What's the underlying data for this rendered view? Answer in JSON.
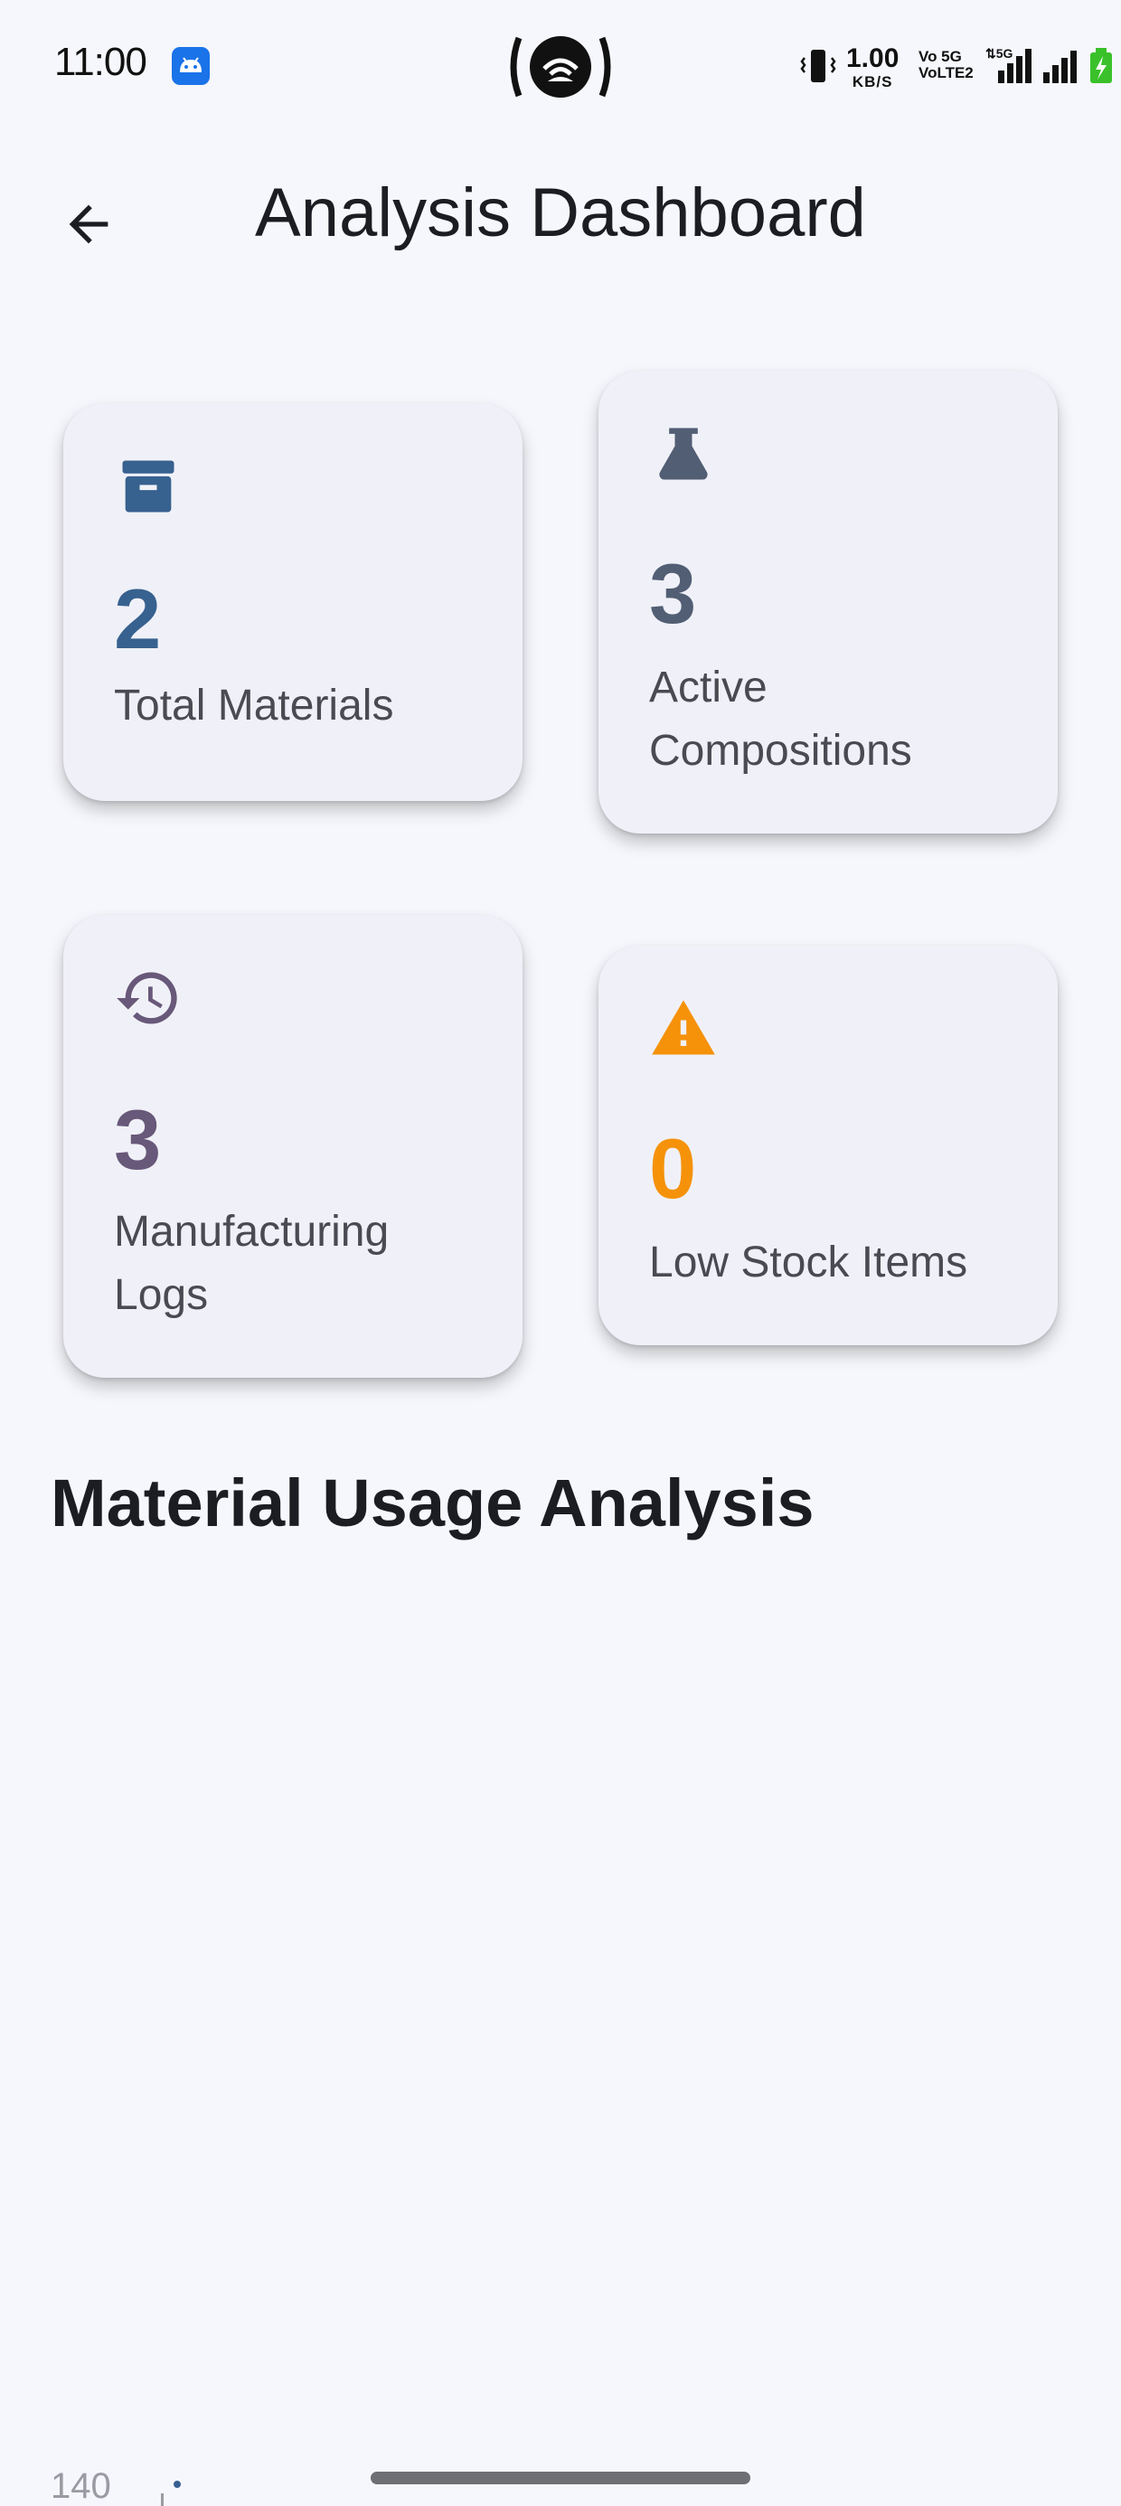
{
  "status_bar": {
    "time": "11:00",
    "net_speed_value": "1.00",
    "net_speed_unit": "KB/S",
    "volte_line1": "Vo 5G",
    "volte_line2": "VoLTE2",
    "icons": [
      "android-notification-icon",
      "hotspot-icon",
      "vibrate-icon",
      "signal-icon",
      "battery-charging-icon"
    ]
  },
  "app_bar": {
    "title": "Analysis Dashboard",
    "back_icon": "arrow-back-icon"
  },
  "cards": {
    "materials": {
      "value": "2",
      "label": "Total Materials",
      "icon": "archive-box-icon",
      "color": "#37618f"
    },
    "compositions": {
      "value": "3",
      "label": "Active Compositions",
      "icon": "flask-icon",
      "color": "#525e74"
    },
    "logs": {
      "value": "3",
      "label": "Manufacturing Logs",
      "icon": "history-icon",
      "color": "#685879"
    },
    "low_stock": {
      "value": "0",
      "label": "Low Stock Items",
      "icon": "warning-icon",
      "color": "#f5920a"
    }
  },
  "section": {
    "title": "Material Usage Analysis"
  },
  "chart": {
    "visible_tick": "140"
  }
}
